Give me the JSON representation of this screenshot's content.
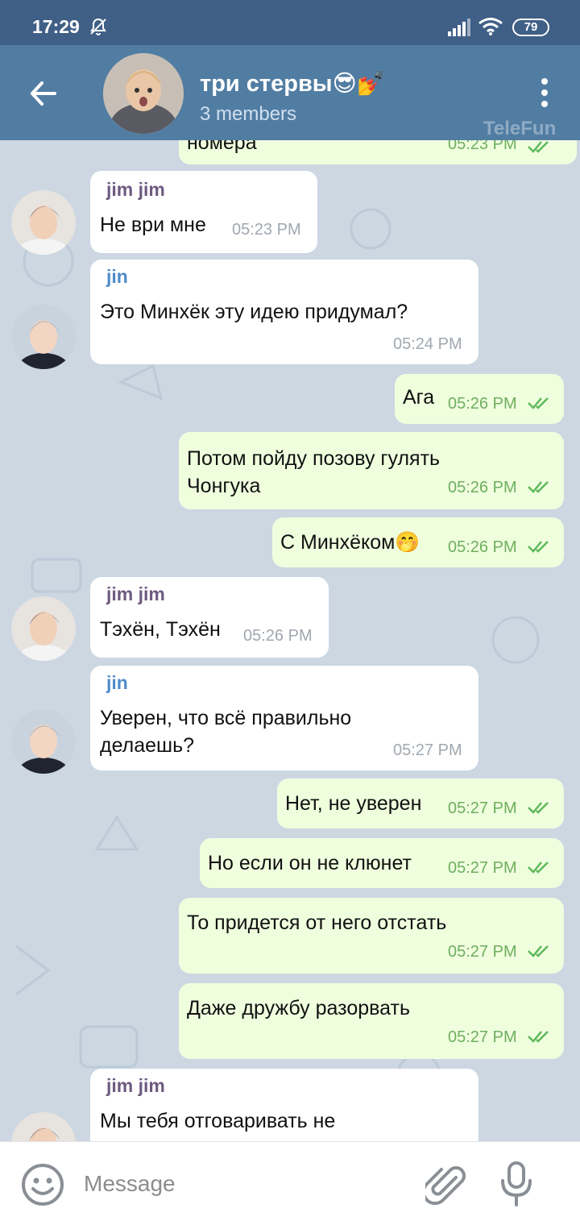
{
  "status_bar": {
    "time": "17:29",
    "battery": "79",
    "icons": [
      "mute-bell-icon",
      "signal-icon",
      "wifi-icon",
      "battery-icon"
    ]
  },
  "header": {
    "title": "три стервы😎💅",
    "subtitle": "3 members",
    "watermark": "TeleFun"
  },
  "messages": [
    {
      "text": "номера",
      "time": "05:23 PM",
      "out": true
    },
    {
      "sender": "jim jim",
      "text": "Не ври мне",
      "time": "05:23 PM",
      "out": false
    },
    {
      "sender": "jin",
      "text": "Это Минхёк эту идею придумал?",
      "time": "05:24 PM",
      "out": false
    },
    {
      "text": "Ага",
      "time": "05:26 PM",
      "out": true
    },
    {
      "text": "Потом пойду позову гулять Чонгука",
      "time": "05:26 PM",
      "out": true
    },
    {
      "text": "С Минхёком🤭",
      "time": "05:26 PM",
      "out": true
    },
    {
      "sender": "jim jim",
      "text": "Тэхён, Тэхён",
      "time": "05:26 PM",
      "out": false
    },
    {
      "sender": "jin",
      "text": "Уверен, что всё правильно делаешь?",
      "time": "05:27 PM",
      "out": false
    },
    {
      "text": "Нет, не уверен",
      "time": "05:27 PM",
      "out": true
    },
    {
      "text": "Но если он не клюнет",
      "time": "05:27 PM",
      "out": true
    },
    {
      "text": "То придется от него отстать",
      "time": "05:27 PM",
      "out": true
    },
    {
      "text": "Даже дружбу разорвать",
      "time": "05:27 PM",
      "out": true
    },
    {
      "sender": "jim jim",
      "text": "Мы тебя отговаривать не",
      "time": "",
      "out": false
    }
  ],
  "composer": {
    "placeholder": "Message"
  },
  "colors": {
    "header": "#527da3",
    "status_bar": "#3f5f86",
    "outgoing_bubble": "#efffde",
    "incoming_bubble": "#ffffff",
    "jim_name": "#6e5a80",
    "jin_name": "#4f8bc9",
    "checks": "#5fb85a"
  }
}
